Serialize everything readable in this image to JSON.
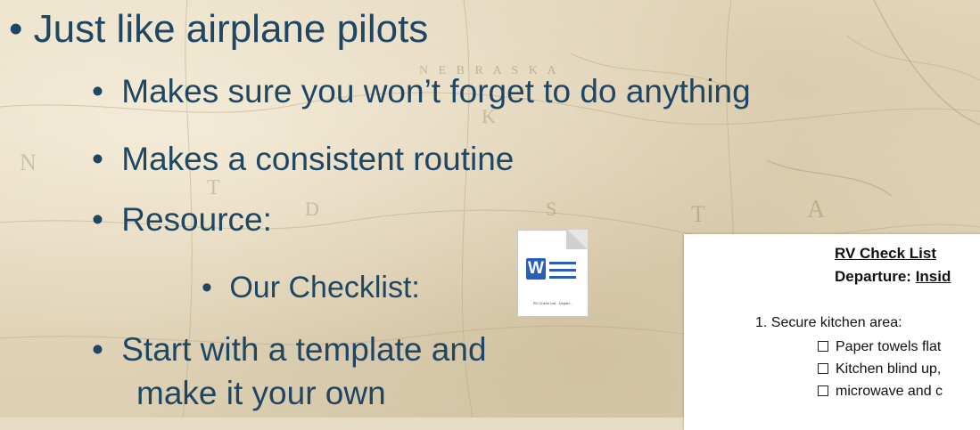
{
  "slide": {
    "bullets": [
      {
        "level": 1,
        "text": "Just like airplane pilots"
      },
      {
        "level": 2,
        "text": "Makes sure you won’t forget to do anything"
      },
      {
        "level": 2,
        "text": "Makes a consistent routine"
      },
      {
        "level": 2,
        "text": "Resource:"
      },
      {
        "level": 3,
        "text": "Our Checklist:"
      },
      {
        "level": 2,
        "text": "Start with a template and"
      },
      {
        "level": 2,
        "text": "make it your own"
      }
    ],
    "bullet_glyph": "•",
    "text_color": "#1f4663"
  },
  "word_icon": {
    "letter": "W",
    "icon": "word-document-icon",
    "caption": "RV Check List - Depart..."
  },
  "map_labels": [
    "N E B R A S K A",
    "N",
    "K",
    "T",
    "D",
    "S",
    "T",
    "A"
  ],
  "document_preview": {
    "title": "RV Check List",
    "subtitle_prefix": "Departure: ",
    "subtitle_underlined": "Insid",
    "list_item": "1.  Secure kitchen area:",
    "checkboxes": [
      "Paper towels flat",
      "Kitchen blind up,",
      "microwave and c"
    ]
  }
}
